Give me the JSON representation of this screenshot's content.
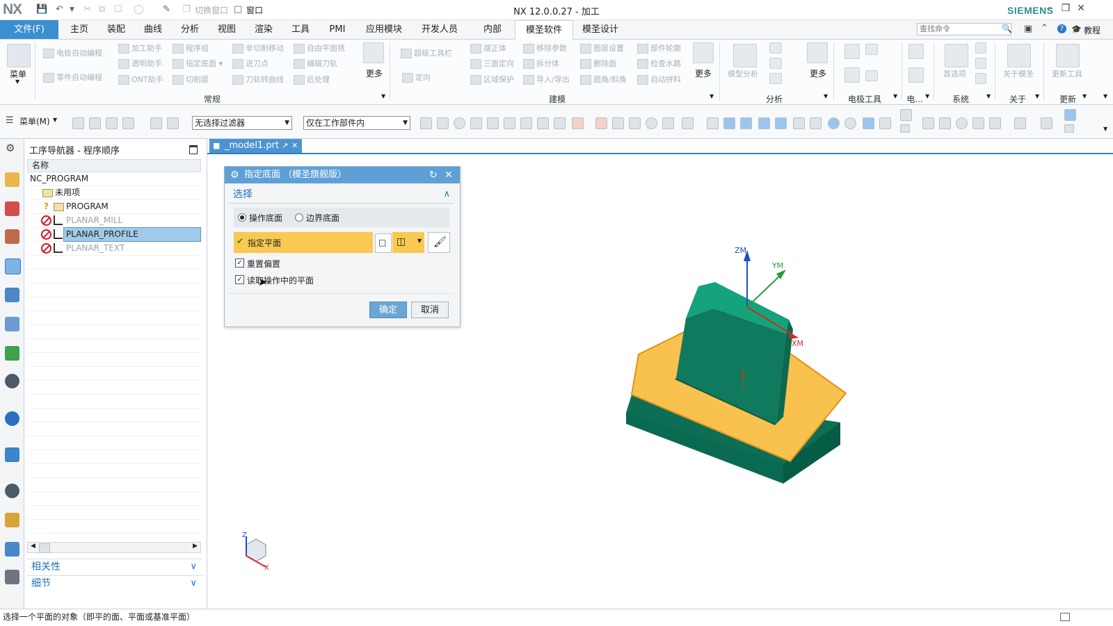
{
  "app": {
    "logo": "NX",
    "title": "NX 12.0.0.27 - 加工",
    "brand": "SIEMENS",
    "quick_access": {
      "switch_window": "切换窗口",
      "window": "窗口"
    },
    "brand_color": "#2a8d9a",
    "accent_color": "#3a8fd1"
  },
  "menubar": {
    "file": "文件(F)",
    "tabs": [
      "主页",
      "装配",
      "曲线",
      "分析",
      "视图",
      "渲染",
      "工具",
      "PMI",
      "应用模块",
      "开发人员",
      "内部",
      "模圣软件",
      "模圣设计"
    ],
    "active_tab": "模圣软件",
    "search_placeholder": "查找命令",
    "tutorial": "教程"
  },
  "ribbon": {
    "menu": "菜单",
    "groups": {
      "general": {
        "label": "常规",
        "items": [
          "电极自动编程",
          "加工助手",
          "程序组",
          "非切削移动",
          "自由平面铣",
          "零件自动编程",
          "透明助手",
          "指定底面",
          "进刀点",
          "编辑刀轨",
          "ONT助手",
          "切削层",
          "刀轨转曲线",
          "后处理"
        ],
        "more": "更多"
      },
      "modeling": {
        "label": "建模",
        "items": [
          "超级工具栏",
          "摆正体",
          "移除参数",
          "图层设置",
          "部件轮廓",
          "定向",
          "三面定向",
          "拆分体",
          "删除面",
          "检查水路",
          "区域保护",
          "导入/导出",
          "圆角/斜角",
          "自动拼料"
        ],
        "more": "更多"
      },
      "analysis": {
        "label": "分析",
        "items": [
          "模型分析"
        ],
        "more": "更多"
      },
      "electrode": {
        "label": "电极工具"
      },
      "electrode2": {
        "label": "电..."
      },
      "system": {
        "label": "系统",
        "items": [
          "首选项"
        ]
      },
      "about": {
        "label": "关于",
        "items": [
          "关于模圣"
        ]
      },
      "update": {
        "label": "更新",
        "items": [
          "更新工具"
        ]
      }
    }
  },
  "toolbar": {
    "menu": "菜单(M)",
    "filter": "无选择过滤器",
    "scope": "仅在工作部件内"
  },
  "navigator": {
    "title": "工序导航器 - 程序顺序",
    "column_name": "名称",
    "items": [
      {
        "name": "NC_PROGRAM",
        "state": "root"
      },
      {
        "name": "未用项",
        "state": "folder"
      },
      {
        "name": "PROGRAM",
        "state": "folder"
      },
      {
        "name": "PLANAR_MILL",
        "state": "greyed"
      },
      {
        "name": "PLANAR_PROFILE",
        "state": "selected"
      },
      {
        "name": "PLANAR_TEXT",
        "state": "greyed"
      }
    ],
    "panels": [
      "相关性",
      "细节"
    ]
  },
  "document": {
    "tab": "_model1.prt"
  },
  "dialog": {
    "title": "指定底面 （模圣旗舰版）",
    "section": "选择",
    "radio_options": [
      "操作底面",
      "边界底面"
    ],
    "selected_radio": "操作底面",
    "specify_plane": "指定平面",
    "checkboxes": [
      {
        "label": "重置偏置",
        "checked": true
      },
      {
        "label": "读取操作中的平面",
        "checked": true
      }
    ],
    "ok": "确定",
    "cancel": "取消"
  },
  "viewport": {
    "axes": {
      "zm": "ZM",
      "ym": "YM",
      "xm": "XM"
    },
    "triad": {
      "z": "Z",
      "x": "X"
    },
    "model_color": "#0f8f6e",
    "highlight_color": "#f7b64a"
  },
  "status": {
    "message": "选择一个平面的对象（即平的面、平面或基准平面）"
  }
}
